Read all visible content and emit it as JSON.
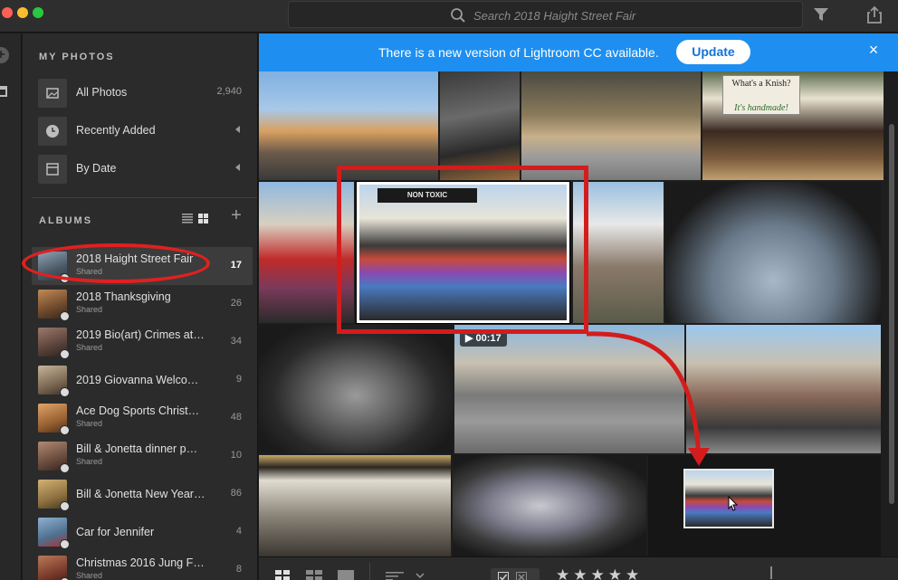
{
  "app": {
    "name": "Lightroom CC"
  },
  "titlebar": {
    "search_placeholder": "Search 2018 Haight Street Fair",
    "icons": [
      "search-icon",
      "filter-icon",
      "share-icon"
    ]
  },
  "sidebar": {
    "my_photos_heading": "MY PHOTOS",
    "nav": [
      {
        "label": "All Photos",
        "count": "2,940",
        "icon": "photos-icon"
      },
      {
        "label": "Recently Added",
        "count": "",
        "icon": "clock-icon"
      },
      {
        "label": "By Date",
        "count": "",
        "icon": "calendar-icon"
      }
    ],
    "albums_heading": "ALBUMS",
    "albums": [
      {
        "title": "2018 Haight Street Fair",
        "subtitle": "Shared",
        "count": "17",
        "selected": true,
        "thumb_color": "#6a7f93"
      },
      {
        "title": "2018 Thanksgiving",
        "subtitle": "Shared",
        "count": "26",
        "selected": false,
        "thumb_color": "#8a6a4a"
      },
      {
        "title": "2019 Bio(art) Crimes at…",
        "subtitle": "Shared",
        "count": "34",
        "selected": false,
        "thumb_color": "#7a5e52"
      },
      {
        "title": "2019 Giovanna Welco…",
        "subtitle": "",
        "count": "9",
        "selected": false,
        "thumb_color": "#9a8770"
      },
      {
        "title": "Ace Dog Sports Christ…",
        "subtitle": "Shared",
        "count": "48",
        "selected": false,
        "thumb_color": "#b0794a"
      },
      {
        "title": "Bill & Jonetta dinner p…",
        "subtitle": "Shared",
        "count": "10",
        "selected": false,
        "thumb_color": "#7d6050"
      },
      {
        "title": "Bill & Jonetta New Year…",
        "subtitle": "",
        "count": "86",
        "selected": false,
        "thumb_color": "#a08a60"
      },
      {
        "title": "Car for Jennifer",
        "subtitle": "",
        "count": "4",
        "selected": false,
        "thumb_color": "#5f7fa0"
      },
      {
        "title": "Christmas 2016 Jung F…",
        "subtitle": "Shared",
        "count": "8",
        "selected": false,
        "thumb_color": "#8a5040"
      }
    ]
  },
  "banner": {
    "message": "There is a new version of Lightroom CC available.",
    "button": "Update",
    "close": "×"
  },
  "video_badge": {
    "duration": "00:17"
  },
  "photo_knish_sign": {
    "line1": "What's a Knish?",
    "line2": "It's handmade!"
  },
  "photo_banner_sign": {
    "text": "NON TOXIC"
  },
  "toolbar": {
    "rating_stars": "★★★★★"
  },
  "colors": {
    "banner_blue": "#1e8ff0",
    "annotation_red": "#d41c1c"
  }
}
